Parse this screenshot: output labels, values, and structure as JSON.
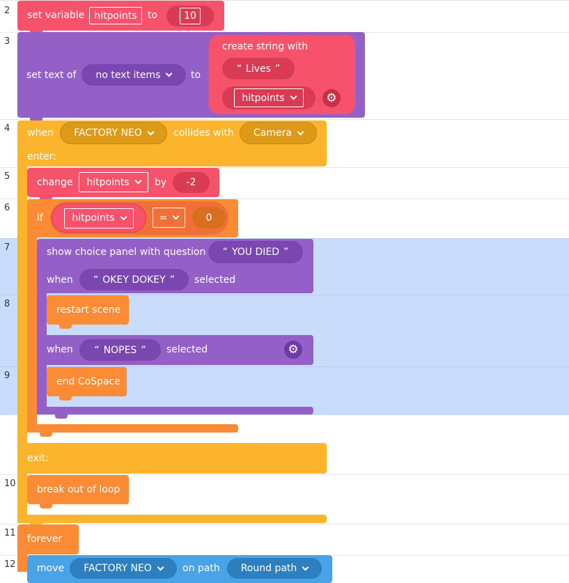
{
  "line_numbers": [
    "2",
    "3",
    "4",
    "5",
    "6",
    "7",
    "8",
    "9",
    "10",
    "11",
    "12"
  ],
  "blocks": {
    "set_variable": {
      "label": "set variable",
      "variable": "hitpoints",
      "to": "to",
      "value": "10"
    },
    "set_text": {
      "label": "set text of",
      "target": "no text items",
      "to": "to",
      "create_string": "create string with",
      "string_item": "Lives",
      "var_item": "hitpoints"
    },
    "when_collides": {
      "when": "when",
      "object": "FACTORY NEO",
      "collides": "collides with",
      "other": "Camera",
      "enter": "enter:",
      "exit": "exit:"
    },
    "change": {
      "label": "change",
      "variable": "hitpoints",
      "by": "by",
      "value": "-2"
    },
    "if_block": {
      "label": "if",
      "variable": "hitpoints",
      "operator": "=",
      "value": "0"
    },
    "choice_panel": {
      "label": "show choice panel with question",
      "question": "YOU DIED",
      "when": "when",
      "option1": "OKEY DOKEY",
      "selected": "selected",
      "option2": "NOPES"
    },
    "restart_scene": {
      "label": "restart scene"
    },
    "end_cospace": {
      "label": "end CoSpace"
    },
    "break_loop": {
      "label": "break out of loop"
    },
    "forever": {
      "label": "forever"
    },
    "move": {
      "label": "move",
      "object": "FACTORY NEO",
      "on_path": "on path",
      "path": "Round path"
    }
  },
  "quote_open": "“",
  "quote_close": "”",
  "gear_icon": "⚙",
  "colors": {
    "variables": "#f7526b",
    "text": "#9460c8",
    "events": "#fbb42b",
    "control": "#fb8b35",
    "motion": "#4aa3e6",
    "highlight": "#c9dcfb"
  }
}
